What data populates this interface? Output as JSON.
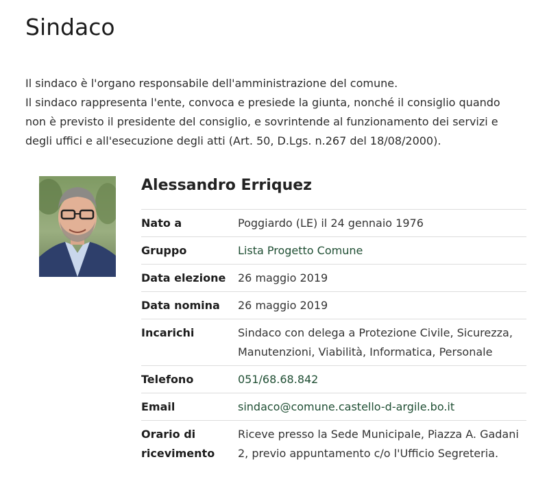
{
  "page": {
    "title": "Sindaco",
    "intro_line1": "Il sindaco è l'organo responsabile dell'amministrazione del comune.",
    "intro_line2": "Il sindaco rappresenta l'ente, convoca e presiede la giunta, nonché il consiglio quando non è previsto il presidente del consiglio, e sovrintende al funzionamento dei servizi e degli uffici e all'esecuzione degli atti (Art. 50, D.Lgs. n.267 del 18/08/2000)."
  },
  "person": {
    "name": "Alessandro Erriquez",
    "photo_icon": "portrait-photo"
  },
  "details": [
    {
      "label": "Nato a",
      "value": "Poggiardo (LE) il 24 gennaio 1976"
    },
    {
      "label": "Gruppo",
      "value": "Lista Progetto Comune"
    },
    {
      "label": "Data elezione",
      "value": "26 maggio 2019"
    },
    {
      "label": "Data nomina",
      "value": "26 maggio 2019"
    },
    {
      "label": "Incarichi",
      "value": "Sindaco con delega a Protezione Civile, Sicurezza, Manutenzioni, Viabilità, Informatica, Personale"
    },
    {
      "label": "Telefono",
      "value": "051/68.68.842"
    },
    {
      "label": "Email",
      "value": "sindaco@comune.castello-d-argile.bo.it"
    },
    {
      "label": "Orario di ricevimento",
      "value": "Riceve presso la Sede Municipale, Piazza A. Gadani 2, previo appuntamento c/o l'Ufficio Segreteria."
    }
  ],
  "colors": {
    "link": "#1f4e33",
    "divider": "#dcdcdc"
  }
}
